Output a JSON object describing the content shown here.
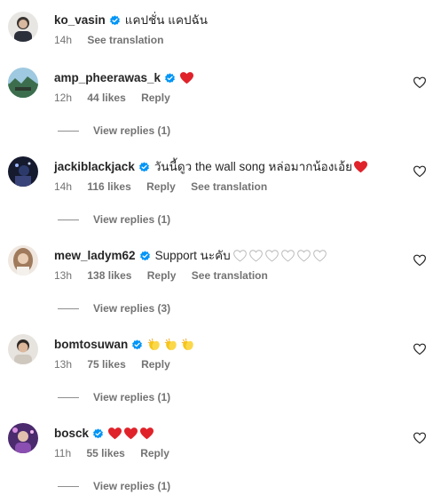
{
  "caption": {
    "username": "ko_vasin",
    "text": "แคปชั่น แคปฉัน",
    "time": "14h",
    "translate": "See translation"
  },
  "comments": [
    {
      "username": "amp_pheerawas_k",
      "text": "",
      "emojis": [
        "red-heart"
      ],
      "time": "12h",
      "likes": "44 likes",
      "reply": "Reply",
      "translate": "",
      "view_replies": "View replies (1)"
    },
    {
      "username": "jackiblackjack",
      "text": "วันนี้ดูว the wall song หล่อมากน้องเอ้ย",
      "emojis": [
        "red-heart"
      ],
      "time": "14h",
      "likes": "116 likes",
      "reply": "Reply",
      "translate": "See translation",
      "view_replies": "View replies (1)"
    },
    {
      "username": "mew_ladym62",
      "text": "Support นะคับ",
      "emojis": [
        "white-heart",
        "white-heart",
        "white-heart",
        "white-heart",
        "white-heart",
        "white-heart"
      ],
      "time": "13h",
      "likes": "138 likes",
      "reply": "Reply",
      "translate": "See translation",
      "view_replies": "View replies (3)"
    },
    {
      "username": "bomtosuwan",
      "text": "",
      "emojis": [
        "clapping-hands",
        "clapping-hands",
        "clapping-hands"
      ],
      "time": "13h",
      "likes": "75 likes",
      "reply": "Reply",
      "translate": "",
      "view_replies": "View replies (1)"
    },
    {
      "username": "bosck",
      "text": "",
      "emojis": [
        "red-heart",
        "red-heart",
        "red-heart"
      ],
      "time": "11h",
      "likes": "55 likes",
      "reply": "Reply",
      "translate": "",
      "view_replies": "View replies (1)"
    }
  ],
  "icons": {
    "verified": "verified-badge-icon",
    "like": "heart-outline-icon"
  },
  "colors": {
    "verified_blue": "#0095f6",
    "heart_red": "#ed4956",
    "meta_gray": "#737373",
    "text": "#262626"
  }
}
